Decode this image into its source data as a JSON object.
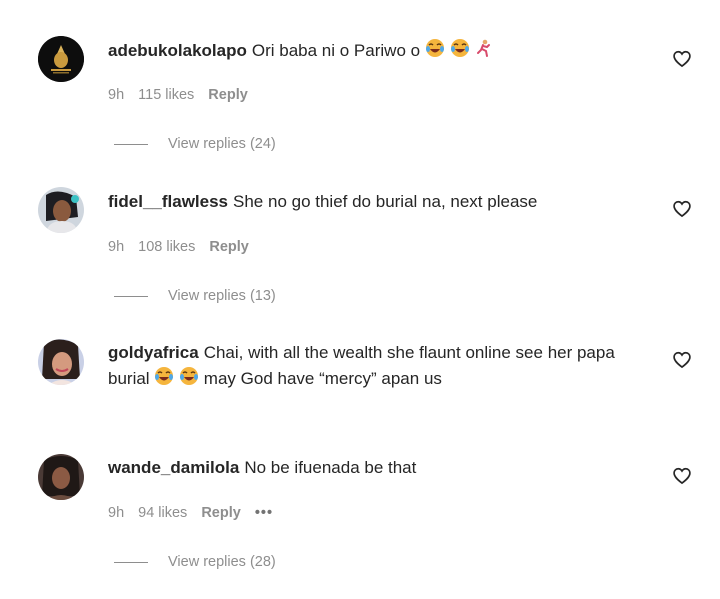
{
  "comments": [
    {
      "username": "adebukolakolapo",
      "text": "Ori baba ni o Pariwo o",
      "emojis": [
        "laughing-crying-emoji",
        "laughing-crying-emoji",
        "running-emoji"
      ],
      "time": "9h",
      "likes": "115 likes",
      "reply": "Reply",
      "view_replies": "View replies (24)"
    },
    {
      "username": "fidel__flawless",
      "text": "She no go thief do burial na, next please",
      "time": "9h",
      "likes": "108 likes",
      "reply": "Reply",
      "view_replies": "View replies (13)"
    },
    {
      "username": "goldyafrica",
      "text_before_emoji": "Chai, with all the wealth she flaunt online see her papa burial",
      "emojis": [
        "laughing-crying-emoji",
        "laughing-crying-emoji"
      ],
      "text_after_emoji": "may God have “mercy” apan us"
    },
    {
      "username": "wande_damilola",
      "text": "No be ifuenada be that",
      "time": "9h",
      "likes": "94 likes",
      "reply": "Reply",
      "more": "•••",
      "view_replies": "View replies (28)"
    }
  ],
  "colors": {
    "text": "#262626",
    "secondary": "#8e8e8e"
  }
}
